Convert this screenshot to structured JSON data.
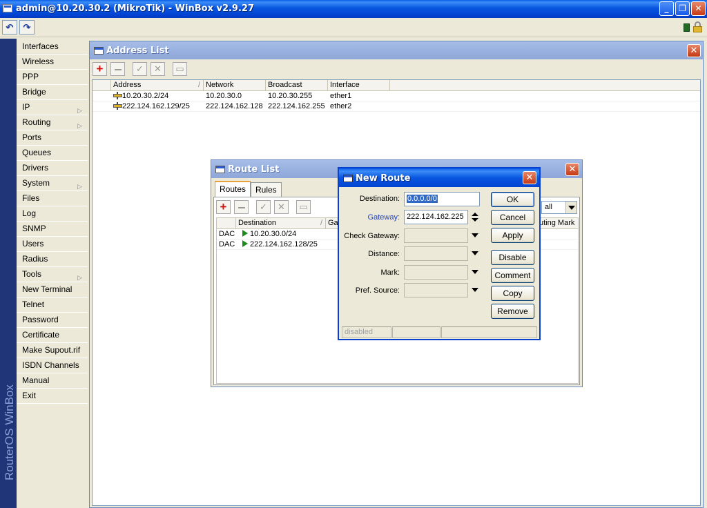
{
  "window": {
    "title": "admin@10.20.30.2 (MikroTik) - WinBox v2.9.27"
  },
  "caption_buttons": {
    "minimize": "_",
    "maximize": "❐",
    "close": "✕"
  },
  "toolbar": {
    "undo": "↶",
    "redo": "↷"
  },
  "brand": {
    "text": "RouterOS WinBox"
  },
  "menu": {
    "items": [
      {
        "label": "Interfaces"
      },
      {
        "label": "Wireless"
      },
      {
        "label": "PPP"
      },
      {
        "label": "Bridge"
      },
      {
        "label": "IP"
      },
      {
        "label": "Routing"
      },
      {
        "label": "Ports"
      },
      {
        "label": "Queues"
      },
      {
        "label": "Drivers"
      },
      {
        "label": "System"
      },
      {
        "label": "Files"
      },
      {
        "label": "Log"
      },
      {
        "label": "SNMP"
      },
      {
        "label": "Users"
      },
      {
        "label": "Radius"
      },
      {
        "label": "Tools"
      },
      {
        "label": "New Terminal"
      },
      {
        "label": "Telnet"
      },
      {
        "label": "Password"
      },
      {
        "label": "Certificate"
      },
      {
        "label": "Make Supout.rif"
      },
      {
        "label": "ISDN Channels"
      },
      {
        "label": "Manual"
      },
      {
        "label": "Exit"
      }
    ],
    "submenu_arrow": "▷"
  },
  "address_list": {
    "title": "Address List",
    "columns": [
      "Address",
      "Network",
      "Broadcast",
      "Interface"
    ],
    "sort_indicator": "/",
    "rows": [
      {
        "address": "10.20.30.2/24",
        "network": "10.20.30.0",
        "broadcast": "10.20.30.255",
        "interface": "ether1"
      },
      {
        "address": "222.124.162.129/25",
        "network": "222.124.162.128",
        "broadcast": "222.124.162.255",
        "interface": "ether2"
      }
    ]
  },
  "route_list": {
    "title": "Route List",
    "tabs": [
      "Routes",
      "Rules"
    ],
    "columns": [
      "Destination",
      "Gat",
      "uting Mark"
    ],
    "filter_value": "all",
    "rows": [
      {
        "flags": "DAC",
        "destination": "10.20.30.0/24"
      },
      {
        "flags": "DAC",
        "destination": "222.124.162.128/25"
      }
    ]
  },
  "new_route": {
    "title": "New Route",
    "fields": {
      "destination": {
        "label": "Destination:",
        "value": "0.0.0.0/0"
      },
      "gateway": {
        "label": "Gateway:",
        "value": "222.124.162.225"
      },
      "check_gateway": {
        "label": "Check Gateway:",
        "value": ""
      },
      "distance": {
        "label": "Distance:",
        "value": ""
      },
      "mark": {
        "label": "Mark:",
        "value": ""
      },
      "pref_source": {
        "label": "Pref. Source:",
        "value": ""
      }
    },
    "buttons": {
      "ok": "OK",
      "cancel": "Cancel",
      "apply": "Apply",
      "disable": "Disable",
      "comment": "Comment",
      "copy": "Copy",
      "remove": "Remove"
    },
    "status": {
      "state": "disabled"
    }
  },
  "colors": {
    "title_blue": "#0a5fe8",
    "inactive_title": "#9cb4e2",
    "link_blue": "#2040c8",
    "brand_bg": "#1f3577"
  }
}
